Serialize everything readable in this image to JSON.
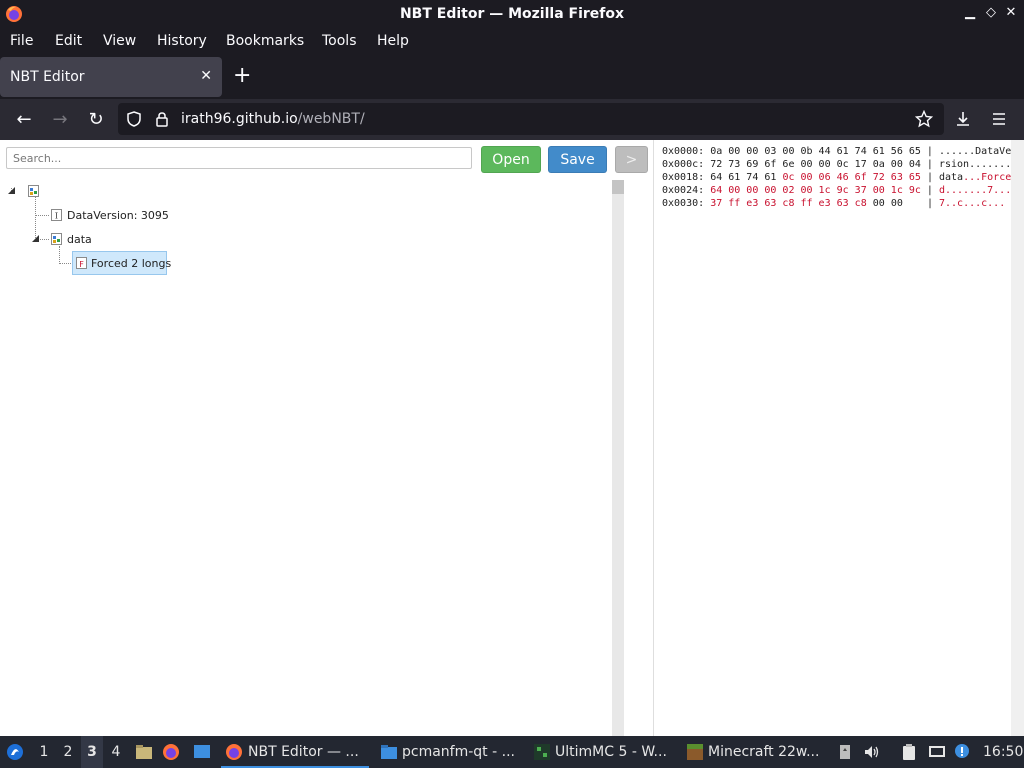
{
  "window": {
    "title": "NBT Editor — Mozilla Firefox",
    "minimize_glyph": "▁",
    "restore_glyph": "◇",
    "close_glyph": "✕"
  },
  "menu": [
    "File",
    "Edit",
    "View",
    "History",
    "Bookmarks",
    "Tools",
    "Help"
  ],
  "tab": {
    "label": "NBT Editor",
    "close_glyph": "✕",
    "new_tab_glyph": "+"
  },
  "nav": {
    "back_glyph": "←",
    "forward_glyph": "→",
    "reload_glyph": "↻",
    "url_host": "irath96.github.io",
    "url_path": "/webNBT/"
  },
  "toolbar": {
    "search_placeholder": "Search...",
    "open_label": "Open",
    "save_label": "Save",
    "next_label": ">"
  },
  "tree": {
    "data_version": "DataVersion: 3095",
    "data": "data",
    "forced": "Forced 2 longs"
  },
  "hex": {
    "rows": [
      {
        "offset": "0x0000:",
        "plain": "0a 00 00 03 00 0b 44 61 74 61 56 65",
        "hl": "",
        "sep": " | ",
        "ascii_plain": "......DataVe",
        "ascii_hl": ""
      },
      {
        "offset": "0x000c:",
        "plain": "72 73 69 6f 6e 00 00 0c 17 0a 00 04",
        "hl": "",
        "sep": " | ",
        "ascii_plain": "rsion.......",
        "ascii_hl": ""
      },
      {
        "offset": "0x0018:",
        "plain": "64 61 74 61 ",
        "hl": "0c 00 06 46 6f 72 63 65",
        "sep": " | ",
        "ascii_plain": "data",
        "ascii_hl": "...Force"
      },
      {
        "offset": "0x0024:",
        "plain": "",
        "hl": "64 00 00 00 02 00 1c 9c 37 00 1c 9c",
        "sep": " | ",
        "ascii_plain": "",
        "ascii_hl": "d.......7..."
      },
      {
        "offset": "0x0030:",
        "plain": "",
        "hl": "37 ff e3 63 c8 ff e3 63 c8",
        "plain_after": " 00 00   ",
        "sep": " | ",
        "ascii_plain": "",
        "ascii_hl": "7..c...c..."
      }
    ]
  },
  "taskbar": {
    "workspaces": [
      "1",
      "2",
      "3",
      "4"
    ],
    "tasks": [
      {
        "label": "NBT Editor — ..."
      },
      {
        "label": "pcmanfm-qt - ..."
      },
      {
        "label": "UltimMC 5 - W..."
      },
      {
        "label": "Minecraft 22w..."
      }
    ],
    "clock": "16:50"
  }
}
